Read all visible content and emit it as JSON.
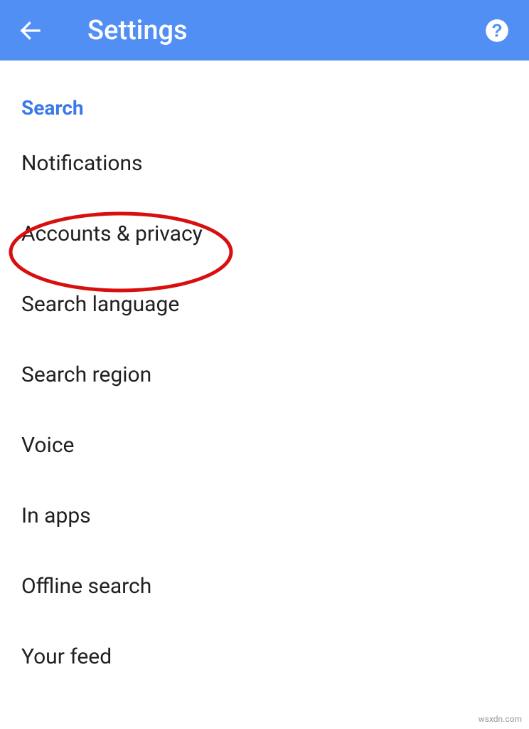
{
  "toolbar": {
    "title": "Settings"
  },
  "section": {
    "header": "Search"
  },
  "items": [
    {
      "label": "Notifications"
    },
    {
      "label": "Accounts & privacy"
    },
    {
      "label": "Search language"
    },
    {
      "label": "Search region"
    },
    {
      "label": "Voice"
    },
    {
      "label": "In apps"
    },
    {
      "label": "Offline search"
    },
    {
      "label": "Your feed"
    }
  ],
  "watermark": "wsxdn.com"
}
